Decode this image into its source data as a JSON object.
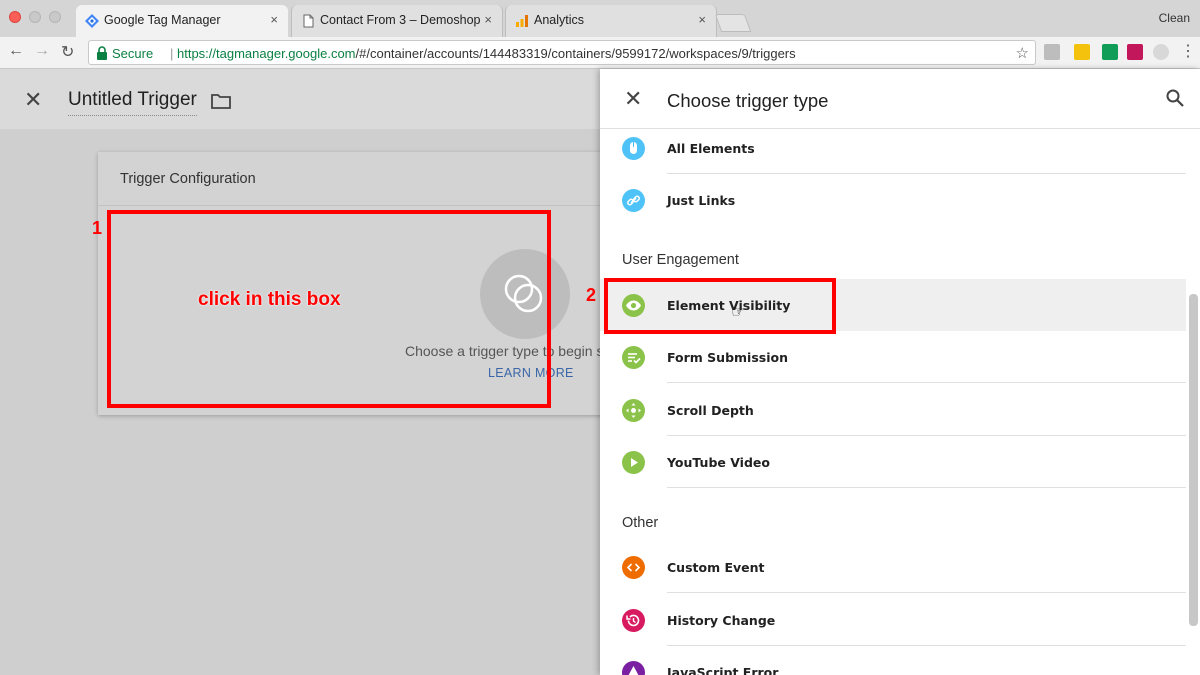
{
  "browser": {
    "tabs": [
      {
        "title": "Google Tag Manager",
        "favicon": "gtm-icon",
        "active": true
      },
      {
        "title": "Contact From 3 – Demoshop",
        "favicon": "document-icon",
        "active": false
      },
      {
        "title": "Analytics",
        "favicon": "analytics-icon",
        "active": false
      }
    ],
    "tab_close": "×",
    "profile_label": "Clean",
    "secure_label": "Secure",
    "url_scheme": "https://",
    "url_host": "tagmanager.google.com",
    "url_path": "/#/container/accounts/144483319/containers/9599172/workspaces/9/triggers"
  },
  "workspace": {
    "trigger_name": "Untitled Trigger",
    "config_title": "Trigger Configuration",
    "choose_text": "Choose a trigger type to begin s",
    "learn_more": "LEARN MORE"
  },
  "annotations": {
    "one": "1",
    "two": "2",
    "click_text": "click in this box"
  },
  "panel": {
    "title": "Choose trigger type",
    "clicks_items": [
      {
        "label": "All Elements",
        "icon": "mouse-icon",
        "color": "#4fc3f7"
      },
      {
        "label": "Just Links",
        "icon": "link-icon",
        "color": "#4fc3f7"
      }
    ],
    "user_engagement_title": "User Engagement",
    "engagement_items": [
      {
        "label": "Element Visibility",
        "icon": "eye-icon",
        "color": "#8bc34a",
        "selected": true
      },
      {
        "label": "Form Submission",
        "icon": "form-icon",
        "color": "#8bc34a"
      },
      {
        "label": "Scroll Depth",
        "icon": "scroll-icon",
        "color": "#8bc34a"
      },
      {
        "label": "YouTube Video",
        "icon": "play-icon",
        "color": "#8bc34a"
      }
    ],
    "other_title": "Other",
    "other_items": [
      {
        "label": "Custom Event",
        "icon": "code-icon",
        "color": "#ef6c00"
      },
      {
        "label": "History Change",
        "icon": "history-icon",
        "color": "#d81b60"
      },
      {
        "label": "JavaScript Error",
        "icon": "warning-icon",
        "color": "#7b1fa2"
      }
    ]
  }
}
